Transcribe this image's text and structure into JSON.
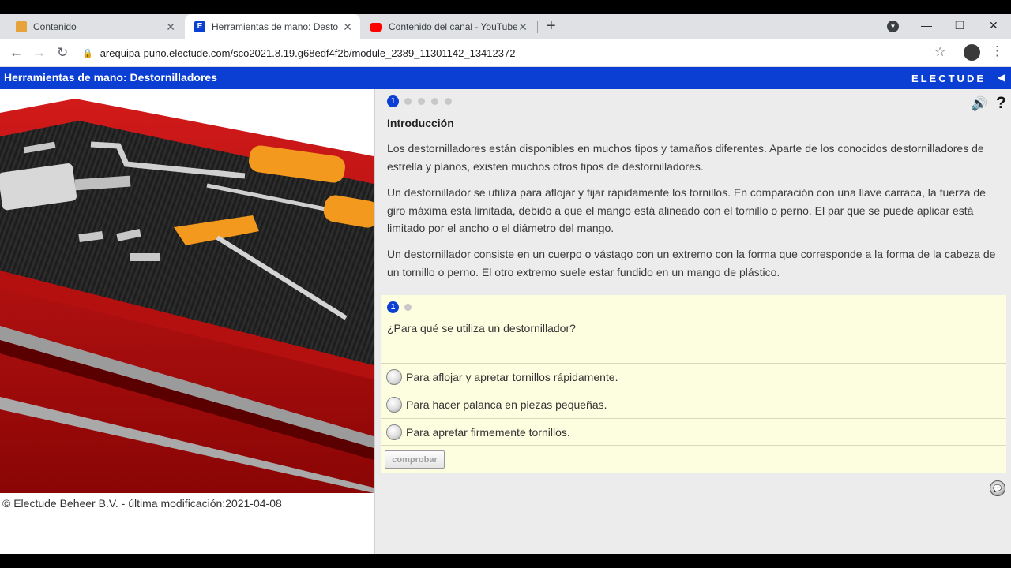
{
  "browser": {
    "tabs": [
      {
        "title": "Contenido",
        "favicon_color": "#e8a23b"
      },
      {
        "title": "Herramientas de mano: Destornil",
        "favicon_color": "#0b3fd4"
      },
      {
        "title": "Contenido del canal - YouTube S",
        "favicon_color": "#ff0000"
      }
    ],
    "url": "arequipa-puno.electude.com/sco2021.8.19.g68edf4f2b/module_2389_11301142_13412372"
  },
  "app": {
    "title": "Herramientas de mano: Destornilladores",
    "brand": "ELECTUDE",
    "copyright": "© Electude Beheer B.V. - última modificación:2021-04-08"
  },
  "lesson": {
    "page_number": "1",
    "section_title": "Introducción",
    "paragraphs": [
      "Los destornilladores están disponibles en muchos tipos y tamaños diferentes. Aparte de los conocidos destornilladores de estrella y planos, existen muchos otros tipos de destornilladores.",
      "Un destornillador se utiliza para aflojar y fijar rápidamente los tornillos. En comparación con una llave carraca, la fuerza de giro máxima está limitada, debido a que el mango está alineado con el tornillo o perno. El par que se puede aplicar está limitado por el ancho o el diámetro del mango.",
      "Un destornillador consiste en un cuerpo o vástago con un extremo con la forma que corresponde a la forma de la cabeza de un tornillo o perno. El otro extremo suele estar fundido en un mango de plástico."
    ]
  },
  "question": {
    "number": "1",
    "text": "¿Para qué se utiliza un destornillador?",
    "options": [
      "Para aflojar y apretar tornillos rápidamente.",
      "Para hacer palanca en piezas pequeñas.",
      "Para apretar firmemente tornillos."
    ],
    "check_label": "comprobar"
  },
  "icons": {
    "speaker": "speaker-icon",
    "help": "help-icon",
    "chat": "chat-icon"
  }
}
